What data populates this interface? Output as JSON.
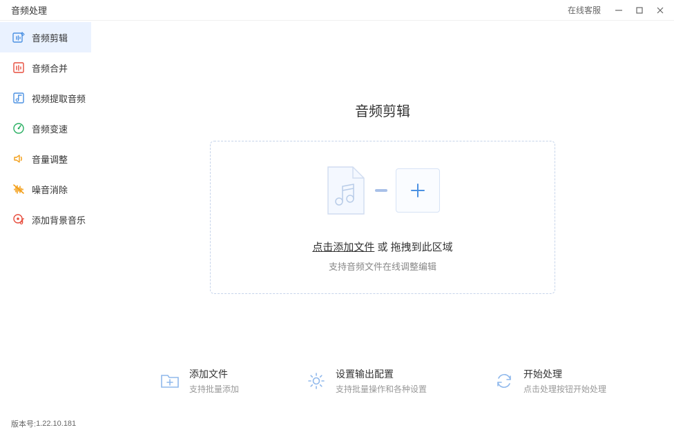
{
  "titlebar": {
    "title": "音频处理",
    "online_service": "在线客服"
  },
  "sidebar": {
    "items": [
      {
        "label": "音频剪辑",
        "icon": "cut",
        "color": "#4a90e2",
        "active": true
      },
      {
        "label": "音频合并",
        "icon": "merge",
        "color": "#e74c3c",
        "active": false
      },
      {
        "label": "视频提取音频",
        "icon": "extract",
        "color": "#4a90e2",
        "active": false
      },
      {
        "label": "音频变速",
        "icon": "speed",
        "color": "#27ae60",
        "active": false
      },
      {
        "label": "音量调整",
        "icon": "volume",
        "color": "#f39c12",
        "active": false
      },
      {
        "label": "噪音消除",
        "icon": "denoise",
        "color": "#f39c12",
        "active": false
      },
      {
        "label": "添加背景音乐",
        "icon": "bgm",
        "color": "#e74c3c",
        "active": false
      }
    ]
  },
  "main": {
    "page_title": "音频剪辑",
    "dropzone": {
      "click_text": "点击添加文件",
      "or_text": " 或 ",
      "drag_text": "拖拽到此区域",
      "subtext": "支持音频文件在线调整编辑"
    }
  },
  "steps": [
    {
      "title": "添加文件",
      "desc": "支持批量添加"
    },
    {
      "title": "设置输出配置",
      "desc": "支持批量操作和各种设置"
    },
    {
      "title": "开始处理",
      "desc": "点击处理按钮开始处理"
    }
  ],
  "footer": {
    "version_label": "版本号:",
    "version": "1.22.10.181"
  }
}
